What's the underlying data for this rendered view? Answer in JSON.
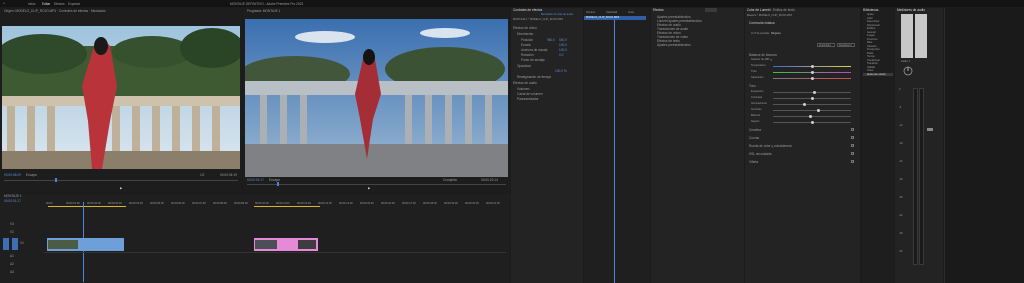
{
  "titlebar": {
    "menu": [
      "Inicio",
      "Editar",
      "Efectos",
      "Exportar"
    ],
    "title": "MONTAJE DEFINITIVO - Adobe Premiere Pro 2022"
  },
  "source_monitor": {
    "tab": "Origen: MODELO_CLIP_ROJO.MP4 · Controles de efectos · Mezclador",
    "timecode_in": "00:00:08:09",
    "fit": "Encajar",
    "quality": "1/2",
    "timecode_out": "00:00:04:19"
  },
  "program_monitor": {
    "tab": "Programa: MONTAJE 1",
    "timecode_in": "00:00:01:17",
    "fit": "Encajar",
    "quality": "Completa",
    "timecode_out": "00:00:22:14"
  },
  "timeline": {
    "tab": "MONTAJE 1",
    "timecode": "00:00:01:17",
    "ruler": [
      "00:00",
      "00:00:01:00",
      "00:00:02:00",
      "00:00:03:00",
      "00:00:04:00",
      "00:00:05:00",
      "00:00:06:00",
      "00:00:07:00",
      "00:00:08:00",
      "00:00:09:00",
      "00:00:10:00",
      "00:00:11:00",
      "00:00:12:00",
      "00:00:13:00",
      "00:00:14:00",
      "00:00:15:00",
      "00:00:16:00",
      "00:00:17:00",
      "00:00:18:00",
      "00:00:19:00",
      "00:00:20:00",
      "00:00:21:00"
    ],
    "tracks": [
      "V3",
      "V2",
      "V1",
      "A1",
      "A2",
      "A3"
    ]
  },
  "effect_controls": {
    "tab": "Controles de efectos",
    "subtab": "Mezclador de clips de audio",
    "clip": "MONTAJE 1 * MODELO_CLIP_ROJO.MP4",
    "sections": [
      "Efectos de vídeo",
      "Movimiento",
      "Posición",
      "Escala",
      "Anchura de escala",
      "Rotación",
      "Punto de anclaje",
      "Opacidad",
      "Reasignación de tiempo",
      "Efectos de audio",
      "Volumen",
      "Canal de volumen",
      "Panoramizador"
    ],
    "values": [
      "960,0",
      "540,0",
      "100,0",
      "100,0",
      "0,0",
      "100,0 %"
    ]
  },
  "project": {
    "tab": "Proyecto: MONTAJE",
    "columns": [
      "Nombre",
      "Velocidad",
      "Inicio"
    ],
    "selected": "MODELO_CLIP_ROJO.MP4"
  },
  "effects_list": {
    "tab": "Efectos",
    "items": [
      "Ajustes preestablecidos",
      "Lumetri ajustes preestablecidos",
      "Efectos de audio",
      "Transiciones de audio",
      "Efectos de vídeo",
      "Transiciones de vídeo",
      "Efectos de texto",
      "Ajustes preestablecidos"
    ]
  },
  "lumetri": {
    "tab": "Color de Lumetri",
    "tab2": "Estilos de texto",
    "clip": "Maestro * MODELO_CLIP_ROJO.MP4",
    "section_basic": "Corrección básica",
    "input_lut": "LUT de entrada",
    "lut_value": "Ninguna",
    "auto": "Automático",
    "reset": "Restablecer",
    "white_balance": "Balance de blancos",
    "wb_labels": [
      "Selector de WB",
      "Temperatura",
      "Tinte",
      "Saturación"
    ],
    "tone": "Tono",
    "tone_labels": [
      "Exposición",
      "Contraste",
      "Iluminaciones",
      "Sombras",
      "Blancos",
      "Negros"
    ],
    "sections": [
      "Creativa",
      "Curvas",
      "Rueda de color y coincidencia",
      "HSL secundaria",
      "Viñeta"
    ]
  },
  "library": {
    "tab": "Bibliotecas",
    "items": [
      "Ajuste",
      "Color",
      "Desenfocar",
      "Distorsionar",
      "Estilizar",
      "Generar",
      "Imagen",
      "Inmersivo",
      "Mate",
      "Obsoleto",
      "Perspectiva",
      "Ruido",
      "Tiempo",
      "Transformar",
      "Transición",
      "Utilidad",
      "Vídeo",
      "Ajuste de Lumetri"
    ]
  },
  "audio_meters": {
    "tab": "Medidores de audio",
    "label": "Audio 1",
    "db": [
      "0",
      "-6",
      "-12",
      "-18",
      "-24",
      "-30",
      "-36",
      "-42",
      "-48",
      "-54"
    ]
  },
  "colors": {
    "accent": "#4b84d8",
    "clip_blue": "#6f9fd8",
    "clip_pink": "#e58ad6",
    "timeline_yellow": "#d7b62a"
  }
}
